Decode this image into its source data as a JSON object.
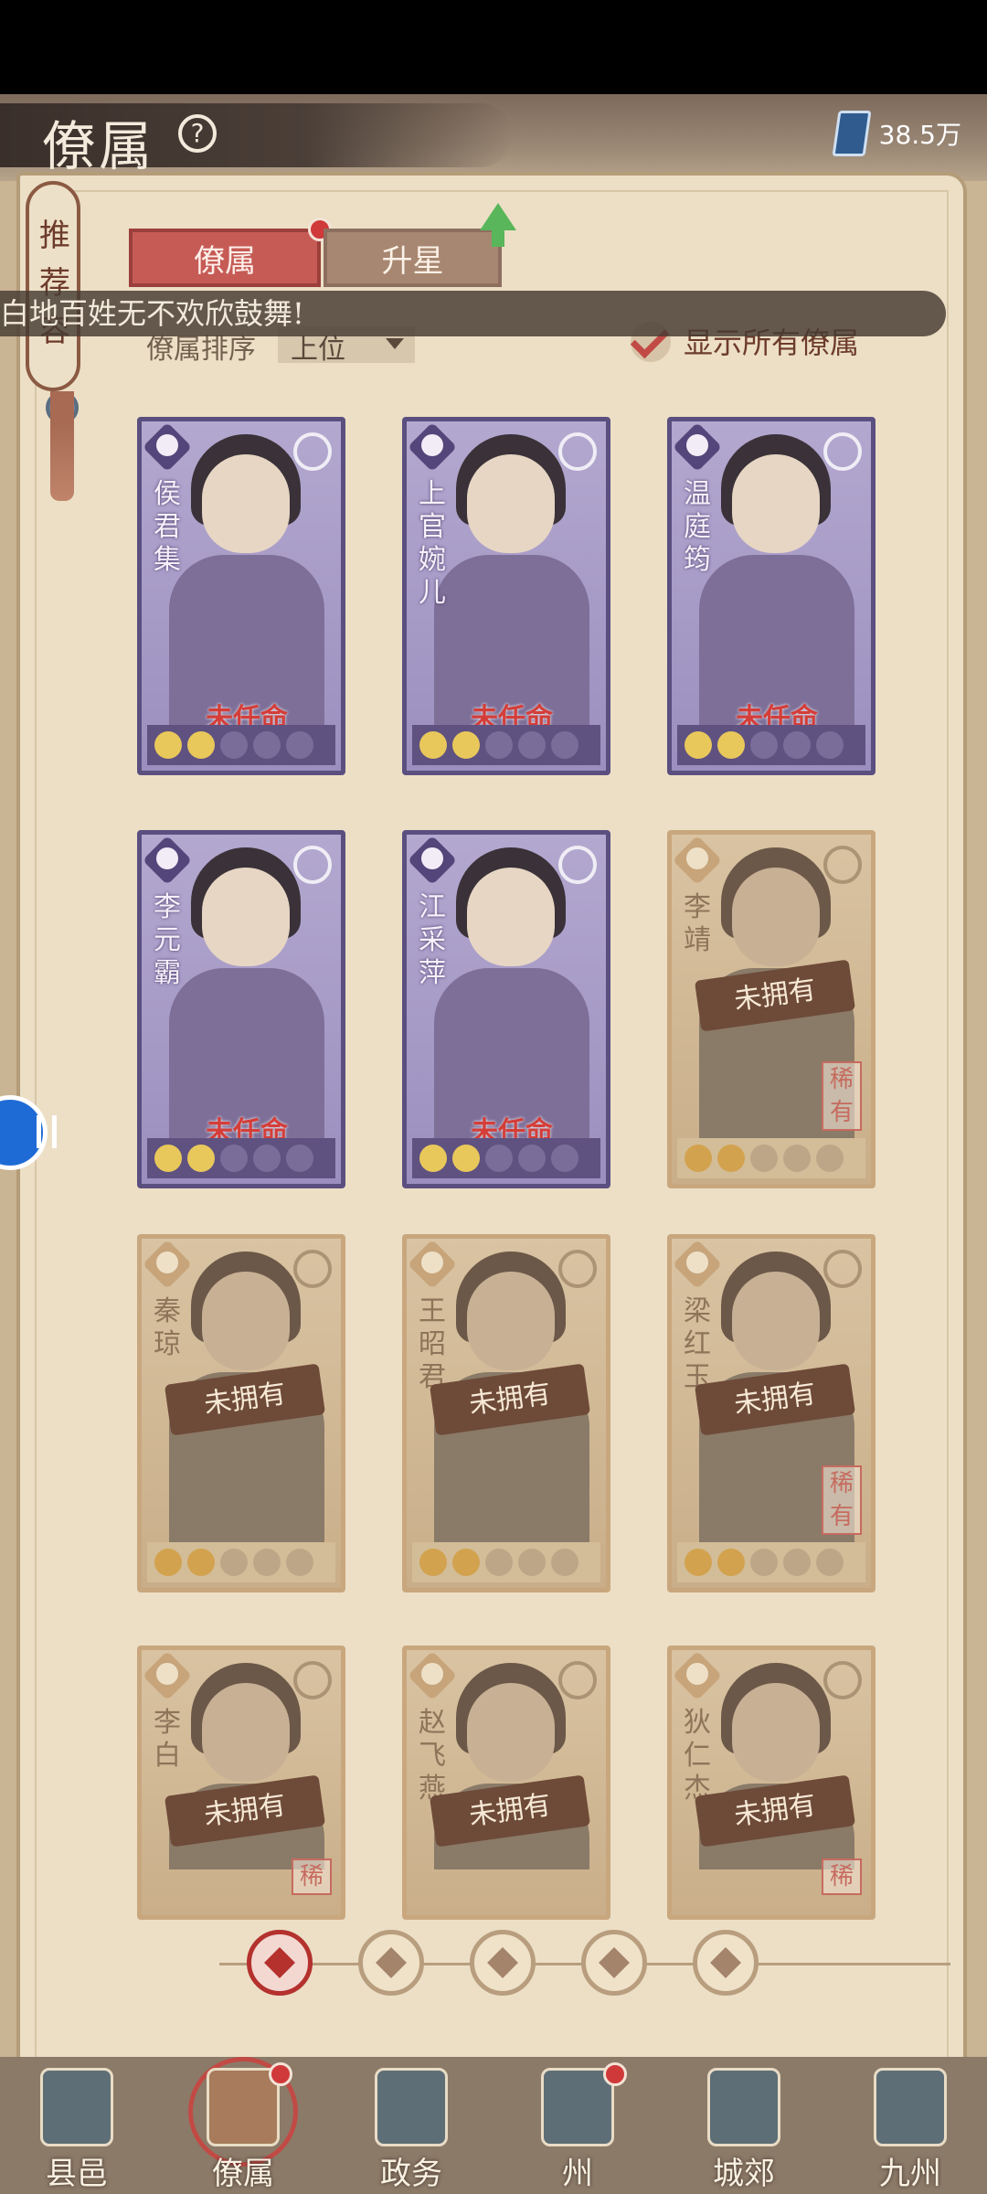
{
  "header": {
    "title": "僚属",
    "help_icon": "question-circle-icon",
    "currency_icon": "book-icon",
    "currency_value": "38.5万"
  },
  "side_tag": {
    "text": "推荐容"
  },
  "tabs": [
    {
      "label": "僚属",
      "active": true,
      "has_dot": true
    },
    {
      "label": "升星",
      "active": false,
      "has_arrow": true
    }
  ],
  "notice": {
    "text": "白地百姓无不欢欣鼓舞!"
  },
  "sort": {
    "label": "僚属排序",
    "value": "上位"
  },
  "filter_toggle": {
    "label": "显示所有僚属",
    "checked": true
  },
  "cards": [
    {
      "name": "侯君集",
      "status": "未任命",
      "owned": true,
      "stars": 2,
      "rare": ""
    },
    {
      "name": "上官婉儿",
      "status": "未任命",
      "owned": true,
      "stars": 2,
      "rare": ""
    },
    {
      "name": "温庭筠",
      "status": "未任命",
      "owned": true,
      "stars": 2,
      "rare": ""
    },
    {
      "name": "李元霸",
      "status": "未任命",
      "owned": true,
      "stars": 2,
      "rare": ""
    },
    {
      "name": "江采萍",
      "status": "未任命",
      "owned": true,
      "stars": 2,
      "rare": ""
    },
    {
      "name": "李靖",
      "status": "未拥有",
      "owned": false,
      "stars": 2,
      "rare": "稀有"
    },
    {
      "name": "秦琼",
      "status": "未拥有",
      "owned": false,
      "stars": 2,
      "rare": ""
    },
    {
      "name": "王昭君",
      "status": "未拥有",
      "owned": false,
      "stars": 2,
      "rare": ""
    },
    {
      "name": "梁红玉",
      "status": "未拥有",
      "owned": false,
      "stars": 2,
      "rare": "稀有"
    },
    {
      "name": "李白",
      "status": "未拥有",
      "owned": false,
      "stars": 0,
      "rare": "稀"
    },
    {
      "name": "赵飞燕",
      "status": "未拥有",
      "owned": false,
      "stars": 0,
      "rare": ""
    },
    {
      "name": "狄仁杰",
      "status": "未拥有",
      "owned": false,
      "stars": 0,
      "rare": "稀"
    }
  ],
  "filters": [
    {
      "icon": "all-filter-icon",
      "active": true
    },
    {
      "icon": "class-bell-icon",
      "active": false
    },
    {
      "icon": "class-cat-icon",
      "active": false
    },
    {
      "icon": "class-fan-icon",
      "active": false
    },
    {
      "icon": "class-horse-icon",
      "active": false
    }
  ],
  "bottom_nav": [
    {
      "label": "县邑",
      "active": false,
      "has_dot": false
    },
    {
      "label": "僚属",
      "active": true,
      "has_dot": true
    },
    {
      "label": "政务",
      "active": false,
      "has_dot": false
    },
    {
      "label": "州",
      "active": false,
      "has_dot": true
    },
    {
      "label": "城郊",
      "active": false,
      "has_dot": false
    },
    {
      "label": "九州",
      "active": false,
      "has_dot": false
    }
  ],
  "colors": {
    "owned_frame": "#5f5280",
    "unowned_frame": "#c9a77e",
    "accent_red": "#c65b56",
    "status_red": "#d43e39"
  }
}
